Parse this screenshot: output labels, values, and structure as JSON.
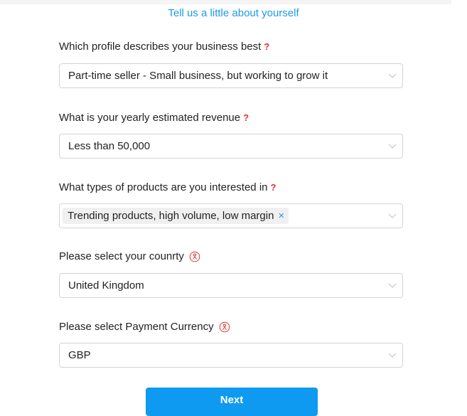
{
  "header": {
    "subtitle": "Tell us a little about yourself"
  },
  "fields": [
    {
      "label": "Which profile describes your business best",
      "value": "Part-time seller - Small business, but working to grow it"
    },
    {
      "label": "What is your yearly estimated revenue",
      "value": "Less than 50,000"
    },
    {
      "label": "What types of products are you interested in",
      "tag": "Trending products, high volume, low margin",
      "tag_remove": "×"
    },
    {
      "label": "Please select your counrty",
      "value": "United Kingdom"
    },
    {
      "label": "Please select Payment Currency",
      "value": "GBP"
    }
  ],
  "required_mark": "?",
  "actions": {
    "next_label": "Next"
  },
  "colors": {
    "accent": "#0e9af0",
    "required": "#e0322f",
    "border": "#d4d4d4"
  },
  "icons": [
    "chevron-down-icon",
    "info-icon",
    "close-icon"
  ]
}
